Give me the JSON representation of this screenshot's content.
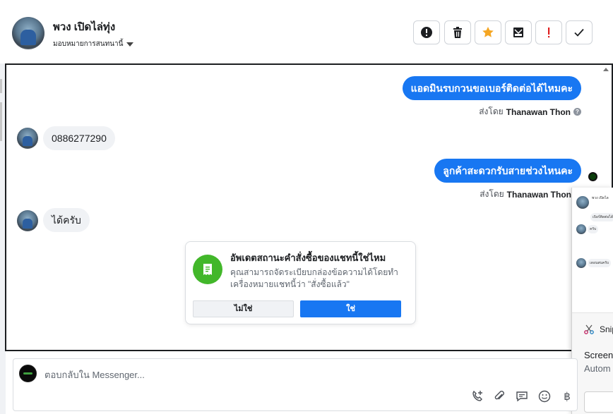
{
  "header": {
    "contact_name": "พวง เปิดไล่ทุ่ง",
    "assign_label": "มอบหมายการสนทนานี้",
    "tools": [
      {
        "name": "exclamation-icon",
        "label": "!"
      },
      {
        "name": "trash-icon",
        "label": ""
      },
      {
        "name": "star-icon",
        "label": ""
      },
      {
        "name": "archive-mail-icon",
        "label": ""
      },
      {
        "name": "spam-icon",
        "label": "!"
      },
      {
        "name": "check-icon",
        "label": ""
      }
    ],
    "colors": {
      "star": "#f5a623",
      "spam": "#e02020"
    }
  },
  "messages": [
    {
      "direction": "out",
      "text": "แอดมินรบกวนขอเบอร์ติดต่อได้ไหมคะ",
      "sender_prefix": "ส่งโดย",
      "sender_name": "Thanawan Thon"
    },
    {
      "direction": "in",
      "text": "0886277290"
    },
    {
      "direction": "out",
      "text": "ลูกค้าสะดวกรับสายช่วงไหนคะ",
      "sender_prefix": "ส่งโดย",
      "sender_name": "Thanawan Thon"
    },
    {
      "direction": "in",
      "text": "ได้ครับ"
    }
  ],
  "prompt": {
    "title": "อัพเดตสถานะคำสั่งซื้อของแชทนี้ใช่ไหม",
    "body": "คุณสามารถจัดระเบียบกล่องข้อความได้โดยทำเครื่องหมายแชทนี้ว่า \"สั่งซื้อแล้ว\"",
    "no_label": "ไม่ใช่",
    "yes_label": "ใช่",
    "icon": "receipt-icon"
  },
  "overlay": {
    "thumb_name": "พวง เปิดไล",
    "thumb_msgs": [
      "เบิอร์ติดต่อได้",
      "ครับ",
      "เดอนสนครับ"
    ],
    "snip_label": "Snip",
    "screen_line1": "Screen",
    "screen_line2": "Autom"
  },
  "composer": {
    "placeholder": "ตอบกลับใน Messenger...",
    "icons": [
      "phone-add-icon",
      "attachment-icon",
      "saved-reply-icon",
      "emoji-icon",
      "baht-icon"
    ]
  },
  "colors": {
    "accent": "#1877f2",
    "bubble_in": "#f0f2f5",
    "prompt_icon_bg": "#42b72a"
  }
}
